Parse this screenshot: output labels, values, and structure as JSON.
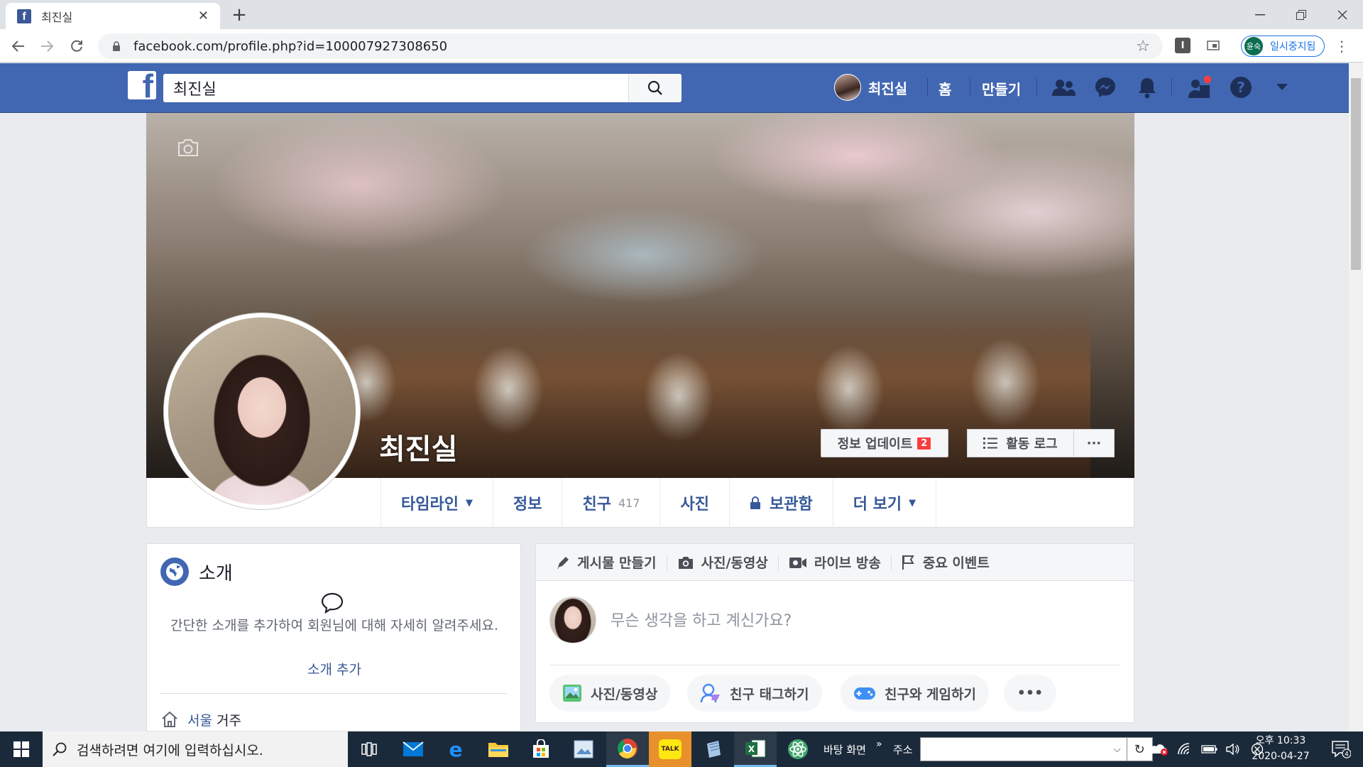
{
  "browser": {
    "tab_title": "최진실",
    "tab_close": "✕",
    "new_tab": "+",
    "url": "facebook.com/profile.php?id=100007927308650",
    "paused_avatar": "윤숙",
    "paused_label": "일시중지됨",
    "ext1": "I"
  },
  "fb": {
    "search_value": "최진실",
    "user_name": "최진실",
    "home": "홈",
    "create": "만들기"
  },
  "profile": {
    "name": "최진실",
    "update_info": "정보 업데이트",
    "update_badge": "2",
    "activity_log": "활동 로그",
    "more_dots": "···",
    "nav": {
      "timeline": "타임라인",
      "about": "정보",
      "friends": "친구",
      "friends_count": "417",
      "photos": "사진",
      "archive": "보관함",
      "more": "더 보기"
    }
  },
  "intro": {
    "title": "소개",
    "desc": "간단한 소개를 추가하여 회원님에 대해 자세히 알려주세요.",
    "add": "소개 추가",
    "lives_city": "서울",
    "lives_suffix": " 거주"
  },
  "composer": {
    "tabs": {
      "create_post": "게시물 만들기",
      "photo_video": "사진/동영상",
      "live": "라이브 방송",
      "life_event": "중요 이벤트"
    },
    "placeholder": "무슨 생각을 하고 계신가요?",
    "actions": {
      "photo_video": "사진/동영상",
      "tag_friends": "친구 태그하기",
      "play_game": "친구와 게임하기",
      "more": "•••"
    }
  },
  "taskbar": {
    "search_placeholder": "검색하려면 여기에 입력하십시오.",
    "desktop": "바탕 화면",
    "address": "주소",
    "time": "오후 10:33",
    "date": "2020-04-27",
    "notif_count": "4",
    "kakao": "TALK"
  },
  "colors": {
    "fb_blue": "#4267b2",
    "link": "#365899",
    "badge_red": "#fa3e3e"
  }
}
